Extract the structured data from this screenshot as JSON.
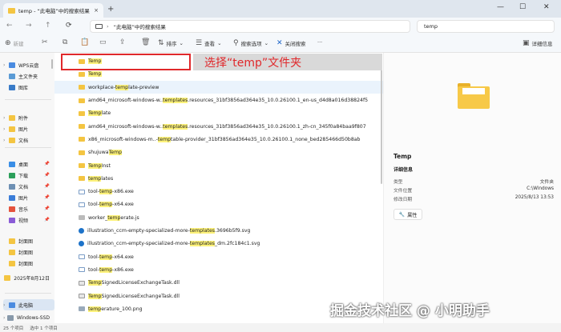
{
  "window": {
    "tab_title": "temp - “此电脑”中的搜索结果",
    "tab_close": "×",
    "new_tab": "+",
    "minimize": "—",
    "maximize": "☐",
    "close": "✕"
  },
  "address": {
    "path": "“此电脑”中的搜索结果",
    "search_value": "temp"
  },
  "toolbar": {
    "new_label": "新建",
    "sort_label": "排序",
    "view_label": "查看",
    "search_options_label": "搜索选项",
    "close_search_label": "关闭搜索",
    "more_label": "···",
    "details_label": "详细信息"
  },
  "sidebar": {
    "items": [
      {
        "label": "WPS云盘",
        "chev": "›",
        "icon": "#4a8be0",
        "pin": ""
      },
      {
        "label": "主文件夹",
        "chev": "",
        "icon": "#5b9bd5",
        "pin": ""
      },
      {
        "label": "图库",
        "chev": "",
        "icon": "#3a7bc8",
        "pin": ""
      },
      {
        "label": "附件",
        "chev": "›",
        "icon": "#f4c542",
        "pin": ""
      },
      {
        "label": "图片",
        "chev": "›",
        "icon": "#f4c542",
        "pin": ""
      },
      {
        "label": "文档",
        "chev": "›",
        "icon": "#f4c542",
        "pin": ""
      },
      {
        "label": "桌面",
        "chev": "",
        "icon": "#3a8ee6",
        "pin": "📌"
      },
      {
        "label": "下载",
        "chev": "",
        "icon": "#2b9f5a",
        "pin": "📌"
      },
      {
        "label": "文档",
        "chev": "",
        "icon": "#6d8fb3",
        "pin": "📌"
      },
      {
        "label": "图片",
        "chev": "",
        "icon": "#3b7dd8",
        "pin": "📌"
      },
      {
        "label": "音乐",
        "chev": "",
        "icon": "#e5533d",
        "pin": "📌"
      },
      {
        "label": "视频",
        "chev": "",
        "icon": "#8a5cd6",
        "pin": "📌"
      },
      {
        "label": "封面图",
        "chev": "",
        "icon": "#f4c542",
        "pin": ""
      },
      {
        "label": "封面图",
        "chev": "",
        "icon": "#f4c542",
        "pin": ""
      },
      {
        "label": "封面图",
        "chev": "",
        "icon": "#f4c542",
        "pin": ""
      },
      {
        "label": "2025年8月12日",
        "chev": "",
        "icon": "#f4c542",
        "pin": ""
      },
      {
        "label": "此电脑",
        "chev": "›",
        "icon": "#4a8be0",
        "pin": ""
      },
      {
        "label": "Windows-SSD",
        "chev": "›",
        "icon": "#8899aa",
        "pin": ""
      }
    ]
  },
  "files": [
    {
      "pre": "",
      "mark": "Temp",
      "post": "",
      "type": "folder"
    },
    {
      "pre": "",
      "mark": "Temp",
      "post": "",
      "type": "folder"
    },
    {
      "pre": "workplace-",
      "mark": "temp",
      "post": "late-preview",
      "type": "folder"
    },
    {
      "pre": "amd64_microsoft-windows-w..",
      "mark": "templates",
      "post": ".resources_31bf3856ad364e35_10.0.26100.1_en-us_d4d8a016d38824f5",
      "type": "folder"
    },
    {
      "pre": "",
      "mark": "Temp",
      "post": "late",
      "type": "folder"
    },
    {
      "pre": "amd64_microsoft-windows-w..",
      "mark": "templates",
      "post": ".resources_31bf3856ad364e35_10.0.26100.1_zh-cn_345f0a84baa9f807",
      "type": "folder"
    },
    {
      "pre": "x86_microsoft-windows-m..-",
      "mark": "temp",
      "post": "table-provider_31bf3856ad364e35_10.0.26100.1_none_bed285466d50b8ab",
      "type": "folder"
    },
    {
      "pre": "shujuwa ",
      "mark": "Temp",
      "post": "",
      "type": "folder"
    },
    {
      "pre": "",
      "mark": "Temp",
      "post": "Inst",
      "type": "folder"
    },
    {
      "pre": "",
      "mark": "temp",
      "post": "lates",
      "type": "folder"
    },
    {
      "pre": "tool-",
      "mark": "temp",
      "post": "-x86.exe",
      "type": "exe"
    },
    {
      "pre": "tool-",
      "mark": "temp",
      "post": "-x64.exe",
      "type": "exe"
    },
    {
      "pre": "worker_",
      "mark": "temp",
      "post": "erate.js",
      "type": "js"
    },
    {
      "pre": "illustration_ccm-empty-specialized-more-",
      "mark": "templates",
      "post": ".3696b5f9.svg",
      "type": "svg"
    },
    {
      "pre": "illustration_ccm-empty-specialized-more-",
      "mark": "templates",
      "post": "_dm.2fc184c1.svg",
      "type": "svg"
    },
    {
      "pre": "tool-",
      "mark": "temp",
      "post": "-x64.exe",
      "type": "exe"
    },
    {
      "pre": "tool-",
      "mark": "temp",
      "post": "-x86.exe",
      "type": "exe"
    },
    {
      "pre": "",
      "mark": "Temp",
      "post": "SignedLicenseExchangeTask.dll",
      "type": "dll"
    },
    {
      "pre": "",
      "mark": "Temp",
      "post": "SignedLicenseExchangeTask.dll",
      "type": "dll"
    },
    {
      "pre": "",
      "mark": "temp",
      "post": "erature_100.png",
      "type": "png"
    }
  ],
  "annotation": {
    "text": "选择“temp”文件夹"
  },
  "details": {
    "name": "Temp",
    "section": "详细信息",
    "rows": [
      {
        "key": "类型",
        "value": "文件夹"
      },
      {
        "key": "文件位置",
        "value": "C:\\Windows"
      },
      {
        "key": "修改日期",
        "value": "2025/8/13 13:53"
      }
    ],
    "properties_label": "属性"
  },
  "status": {
    "count": "25 个项目",
    "selected": "选中 1 个项目"
  },
  "watermark": "掘金技术社区 @ 小明助手",
  "colors": {
    "accent": "#0067c0",
    "highlight_row": "#eaf3fc",
    "search_hit": "#fdf27a",
    "annotation_red": "#e0282b"
  }
}
